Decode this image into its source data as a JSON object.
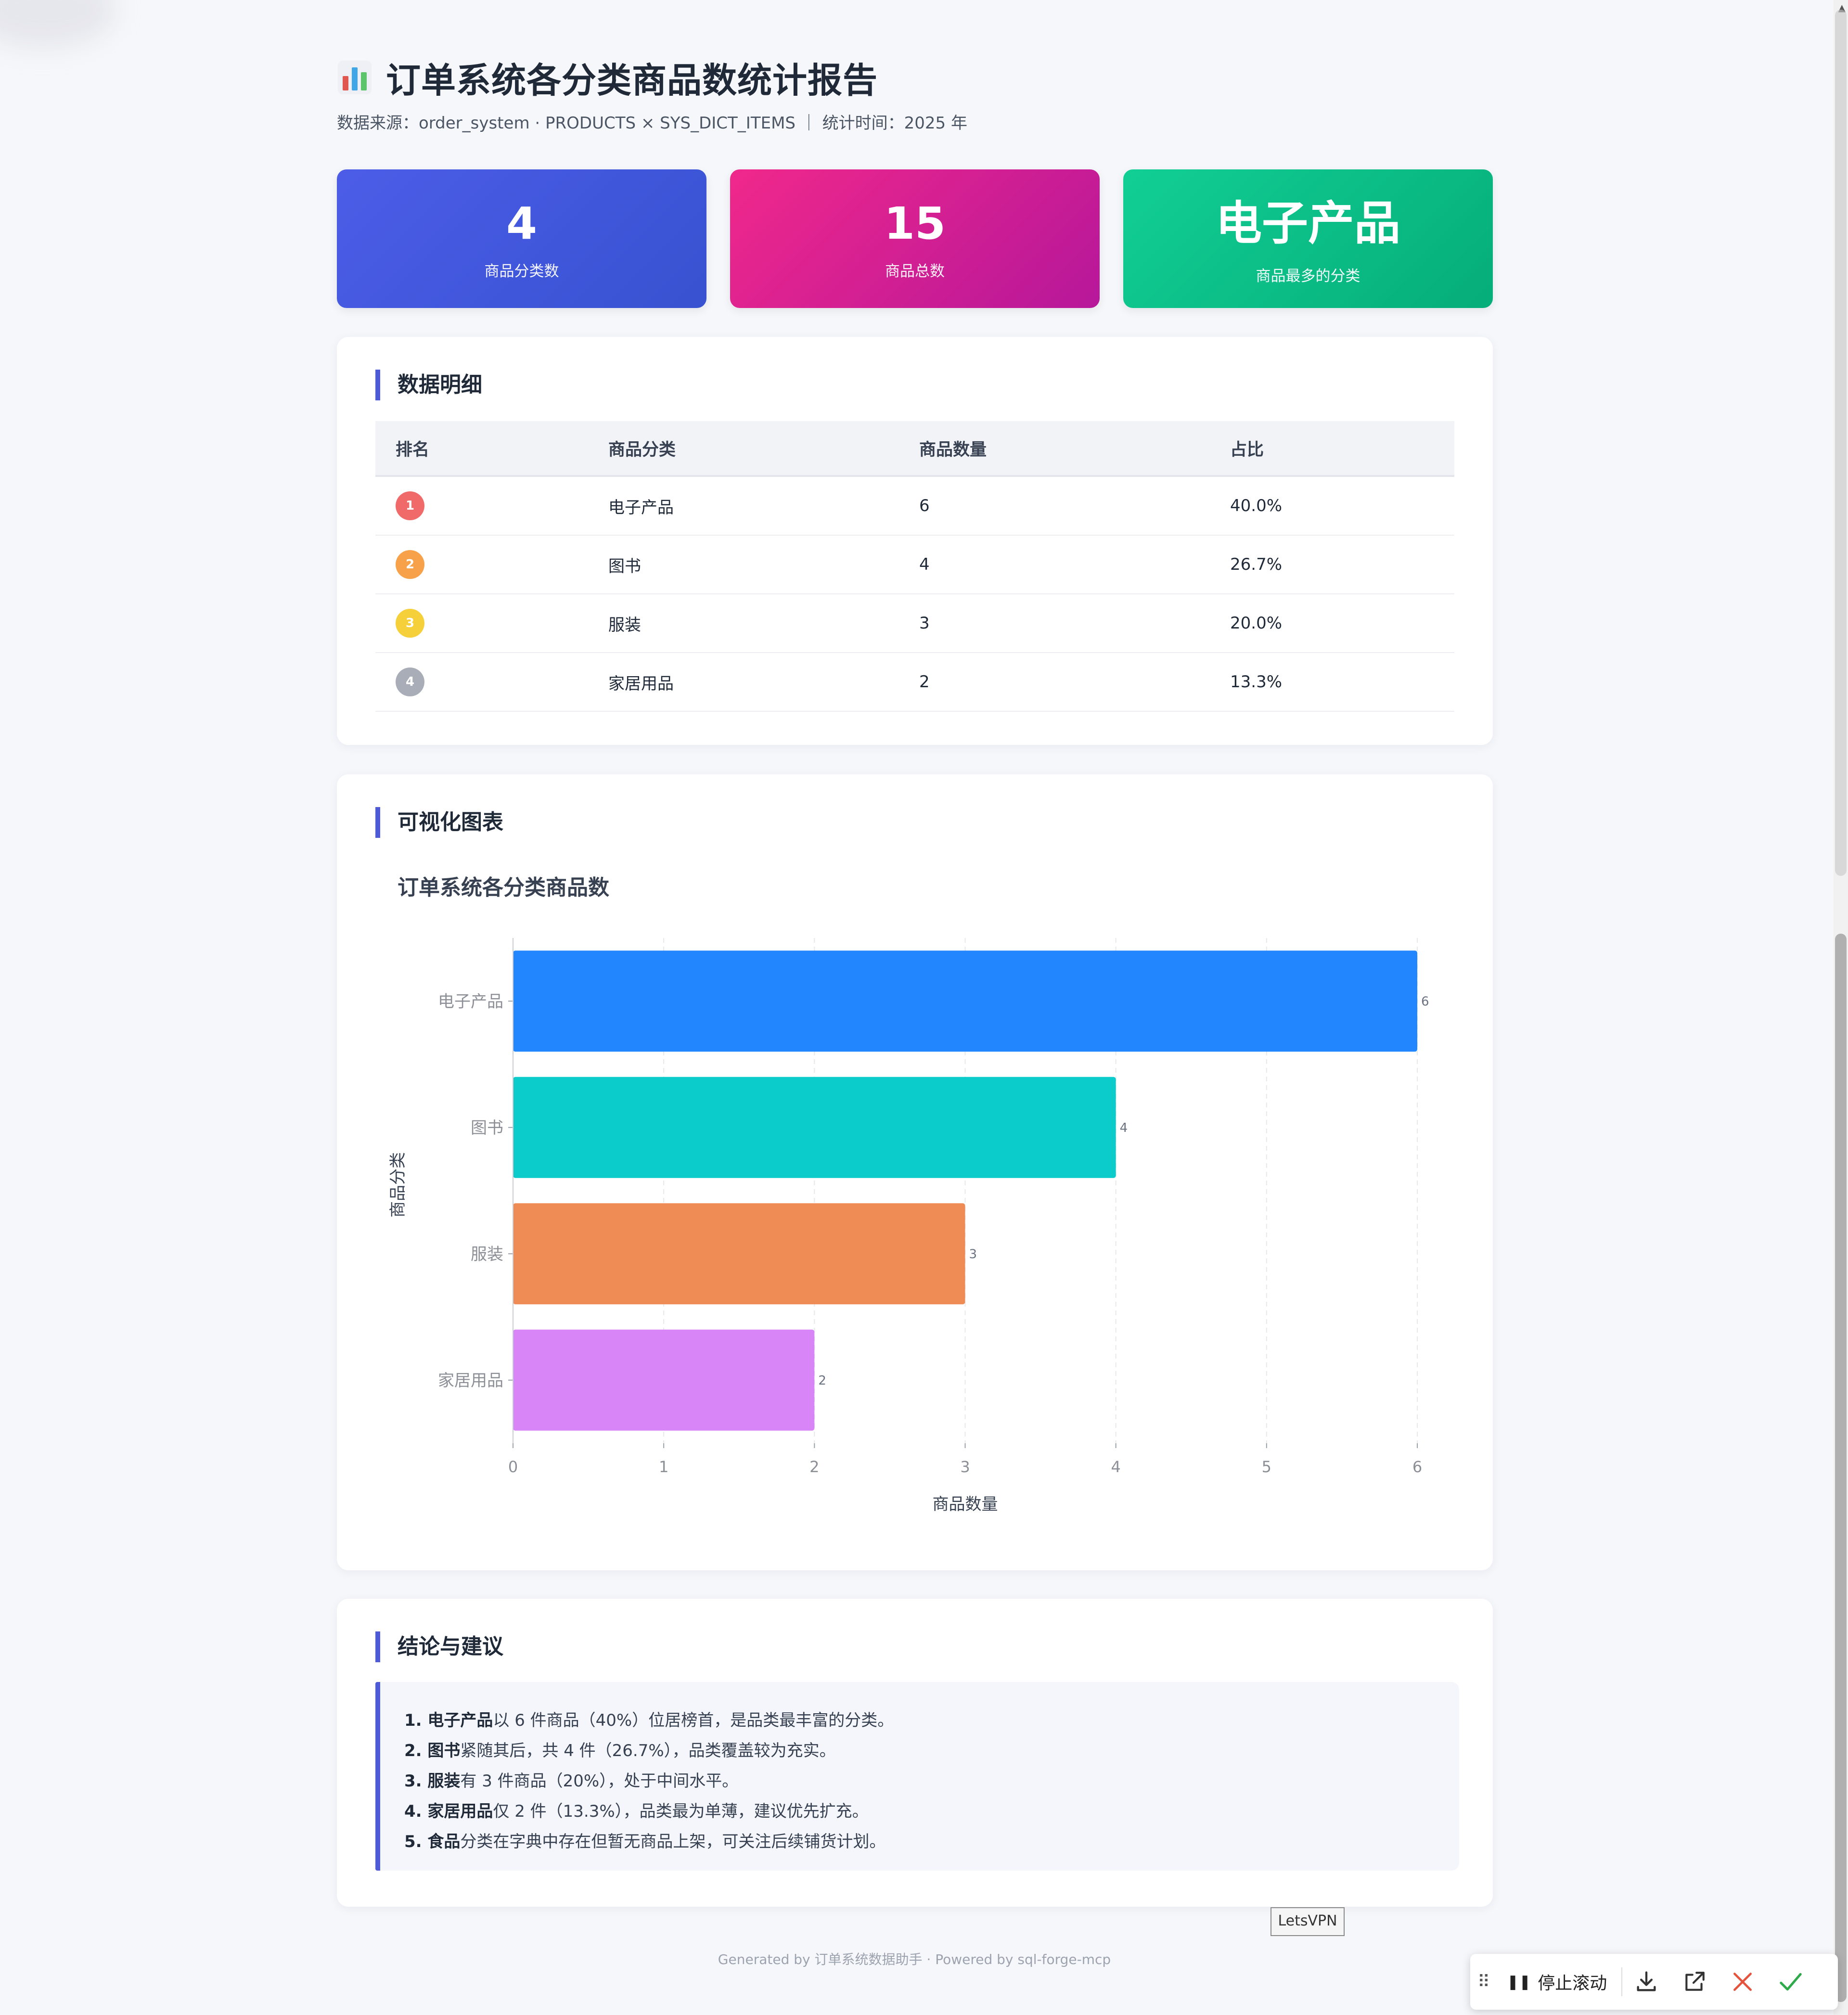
{
  "report": {
    "title": "订单系统各分类商品数统计报告",
    "subtitle": "数据来源：order_system · PRODUCTS × SYS_DICT_ITEMS ｜ 统计时间：2025 年"
  },
  "kpis": [
    {
      "value": "4",
      "label": "商品分类数"
    },
    {
      "value": "15",
      "label": "商品总数"
    },
    {
      "value": "电子产品",
      "label": "商品最多的分类"
    }
  ],
  "table_section": {
    "heading": "数据明细",
    "columns": [
      "排名",
      "商品分类",
      "商品数量",
      "占比"
    ],
    "rows": [
      {
        "rank": "1",
        "category": "电子产品",
        "count": "6",
        "share": "40.0%",
        "badge_color": "#f06a6a"
      },
      {
        "rank": "2",
        "category": "图书",
        "count": "4",
        "share": "26.7%",
        "badge_color": "#f7a24b"
      },
      {
        "rank": "3",
        "category": "服装",
        "count": "3",
        "share": "20.0%",
        "badge_color": "#f5d03b"
      },
      {
        "rank": "4",
        "category": "家居用品",
        "count": "2",
        "share": "13.3%",
        "badge_color": "#a8adb7"
      }
    ]
  },
  "chart_section": {
    "heading": "可视化图表"
  },
  "chart_data": {
    "type": "bar",
    "orientation": "horizontal",
    "title": "订单系统各分类商品数",
    "categories": [
      "电子产品",
      "图书",
      "服装",
      "家居用品"
    ],
    "values": [
      6,
      4,
      3,
      2
    ],
    "colors": [
      "#2286ff",
      "#0bccca",
      "#ef8c55",
      "#d785f7"
    ],
    "xlabel": "商品数量",
    "ylabel": "商品分类",
    "xlim": [
      0,
      6
    ],
    "xticks": [
      0,
      1,
      2,
      3,
      4,
      5,
      6
    ],
    "grid": "vertical dashed",
    "data_labels": true
  },
  "conclusion_section": {
    "heading": "结论与建议",
    "items": [
      {
        "num": "1.",
        "bold": "电子产品",
        "text": "以 6 件商品（40%）位居榜首，是品类最丰富的分类。"
      },
      {
        "num": "2.",
        "bold": "图书",
        "text": "紧随其后，共 4 件（26.7%），品类覆盖较为充实。"
      },
      {
        "num": "3.",
        "bold": "服装",
        "text": "有 3 件商品（20%），处于中间水平。"
      },
      {
        "num": "4.",
        "bold": "家居用品",
        "text": "仅 2 件（13.3%），品类最为单薄，建议优先扩充。"
      },
      {
        "num": "5.",
        "bold": "食品",
        "text": "分类在字典中存在但暂无商品上架，可关注后续铺货计划。"
      }
    ]
  },
  "overlay": {
    "vpn_label": "LetsVPN",
    "footer": "Generated by 订单系统数据助手 · Powered by sql-forge-mcp",
    "toolbar": {
      "pause_label": "停止滚动",
      "icons": [
        "drag-grip-icon",
        "pause-icon",
        "download-icon",
        "open-external-icon",
        "close-icon",
        "check-icon"
      ]
    }
  },
  "colors": {
    "accent": "#4f5bd5",
    "kpi_blue": "#3f55dc",
    "kpi_pink": "#e0228f",
    "kpi_green": "#0bbf86",
    "close_red": "#e5533d",
    "check_green": "#2faa4a"
  }
}
